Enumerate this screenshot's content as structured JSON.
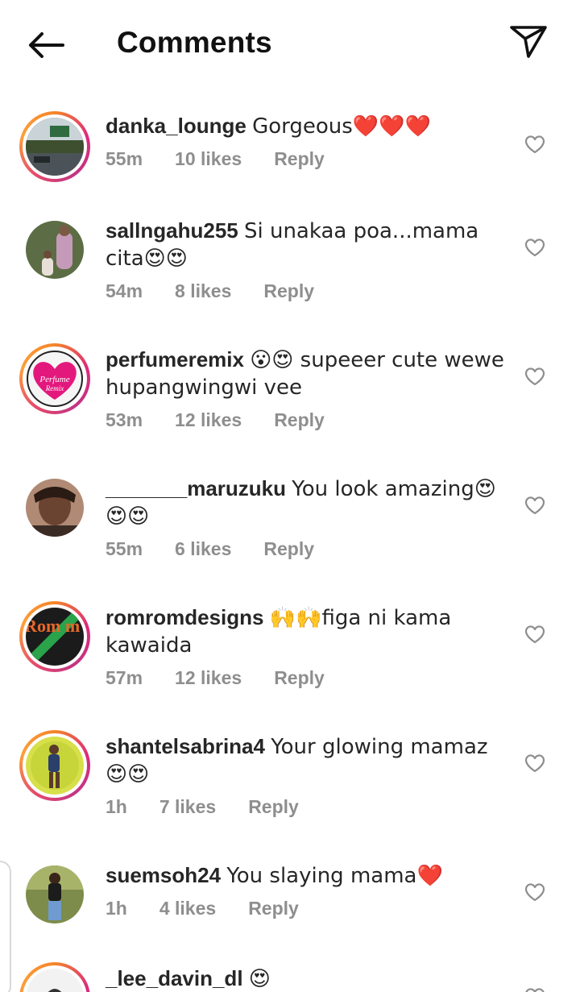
{
  "header": {
    "title": "Comments",
    "back_icon": "arrow-left-icon",
    "share_icon": "send-icon"
  },
  "colors": {
    "text": "#262626",
    "muted": "#8e8e8e",
    "heart_red": "#e0245e",
    "story_ring_start": "#f58529",
    "story_ring_end": "#dd2a7b"
  },
  "comments": [
    {
      "username": "danka_lounge",
      "text": "Gorgeous❤️❤️❤️",
      "time": "55m",
      "likes": "10 likes",
      "reply": "Reply"
    },
    {
      "username": "sallngahu255",
      "text": "Si unakaa poa...mama cita😍😍",
      "time": "54m",
      "likes": "8 likes",
      "reply": "Reply"
    },
    {
      "username": "perfumeremix",
      "text": "😮😍 supeeer cute wewe hupangwingwi vee",
      "time": "53m",
      "likes": "12 likes",
      "reply": "Reply"
    },
    {
      "username": "_______maruzuku",
      "text": "You look amazing😍😍😍",
      "time": "55m",
      "likes": "6 likes",
      "reply": "Reply"
    },
    {
      "username": "romromdesigns",
      "text": "🙌🙌figa ni kama kawaida",
      "time": "57m",
      "likes": "12 likes",
      "reply": "Reply"
    },
    {
      "username": "shantelsabrina4",
      "text": "Your glowing mamaz 😍😍",
      "time": "1h",
      "likes": "7 likes",
      "reply": "Reply"
    },
    {
      "username": "suemsoh24",
      "text": "You slaying mama❤️",
      "time": "1h",
      "likes": "4 likes",
      "reply": "Reply"
    },
    {
      "username": "_lee_davin_dl",
      "text": "😍",
      "time": "",
      "likes": "",
      "reply": ""
    }
  ],
  "avatar_logos": {
    "perfumeremix_line1": "Perfume",
    "perfumeremix_line2": "Remix",
    "romrom_letters": "R Rom m"
  }
}
